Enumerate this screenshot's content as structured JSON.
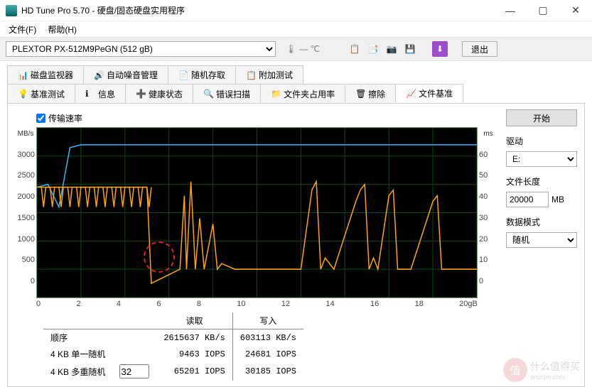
{
  "window": {
    "title": "HD Tune Pro 5.70 - 硬盘/固态硬盘实用程序"
  },
  "menu": {
    "file": "文件(F)",
    "help": "帮助(H)"
  },
  "toolbar": {
    "drive": "PLEXTOR PX-512M9PeGN (512 gB)",
    "temp": "— ℃",
    "exit": "退出"
  },
  "tabs_top": [
    {
      "label": "磁盘监视器"
    },
    {
      "label": "自动噪音管理"
    },
    {
      "label": "随机存取"
    },
    {
      "label": "附加测试"
    }
  ],
  "tabs_bottom": [
    {
      "label": "基准测试"
    },
    {
      "label": "信息"
    },
    {
      "label": "健康状态"
    },
    {
      "label": "错误扫描"
    },
    {
      "label": "文件夹占用率"
    },
    {
      "label": "擦除"
    },
    {
      "label": "文件基准"
    }
  ],
  "checkbox": {
    "transfer": "传输速率"
  },
  "chart_data": {
    "type": "line",
    "xlabel": "gB",
    "ylabel_left": "MB/s",
    "ylabel_right": "ms",
    "xlim": [
      0,
      20
    ],
    "ylim_left": [
      0,
      3000
    ],
    "ylim_right": [
      0,
      60
    ],
    "x_ticks": [
      0,
      2,
      4,
      6,
      8,
      10,
      12,
      14,
      16,
      18,
      20
    ],
    "y_ticks_left": [
      0,
      500,
      1000,
      1500,
      2000,
      2500,
      3000
    ],
    "y_ticks_right": [
      0,
      10,
      20,
      30,
      40,
      50,
      60
    ],
    "series": [
      {
        "name": "read_transfer",
        "color": "#35b7ff",
        "axis": "left",
        "x": [
          0,
          0.5,
          1,
          1.5,
          2,
          20
        ],
        "y": [
          1950,
          2000,
          1600,
          2650,
          2700,
          2700
        ]
      },
      {
        "name": "write_transfer",
        "color": "#ffa500",
        "axis": "left",
        "x": [
          0,
          5,
          5.2,
          6.5,
          6.7,
          6.8,
          7,
          7.2,
          7.4,
          7.6,
          8,
          8.2,
          8.4,
          9,
          10,
          11,
          12,
          12.5,
          12.7,
          12.9,
          13.1,
          13.5,
          14.5,
          14.7,
          14.9,
          15.1,
          15.3,
          15.5,
          16,
          16.2,
          16.4,
          17,
          18,
          18.2,
          18.4,
          19,
          20
        ],
        "y": [
          1950,
          1950,
          250,
          500,
          1800,
          500,
          2050,
          500,
          1400,
          500,
          1300,
          500,
          600,
          500,
          500,
          500,
          500,
          1900,
          2050,
          500,
          700,
          500,
          1700,
          1900,
          2000,
          500,
          700,
          500,
          1800,
          1900,
          500,
          500,
          1700,
          1800,
          500,
          500,
          500
        ]
      }
    ],
    "grid": {
      "color": "#0a3a0a"
    }
  },
  "results": {
    "col_read": "读取",
    "col_write": "写入",
    "rows": [
      {
        "label": "顺序",
        "read": "2615637 KB/s",
        "write": "603113 KB/s"
      },
      {
        "label": "4 KB 单一随机",
        "read": "9463 IOPS",
        "write": "24681 IOPS"
      },
      {
        "label": "4 KB 多重随机",
        "read": "65201 IOPS",
        "write": "30185 IOPS"
      }
    ],
    "queue_depth": "32"
  },
  "side": {
    "start": "开始",
    "drive_label": "驱动",
    "drive_value": "E:",
    "filelen_label": "文件长度",
    "filelen_value": "20000",
    "filelen_unit": "MB",
    "mode_label": "数据模式",
    "mode_value": "随机"
  },
  "watermark": {
    "char": "值",
    "text": "什么值得买"
  }
}
